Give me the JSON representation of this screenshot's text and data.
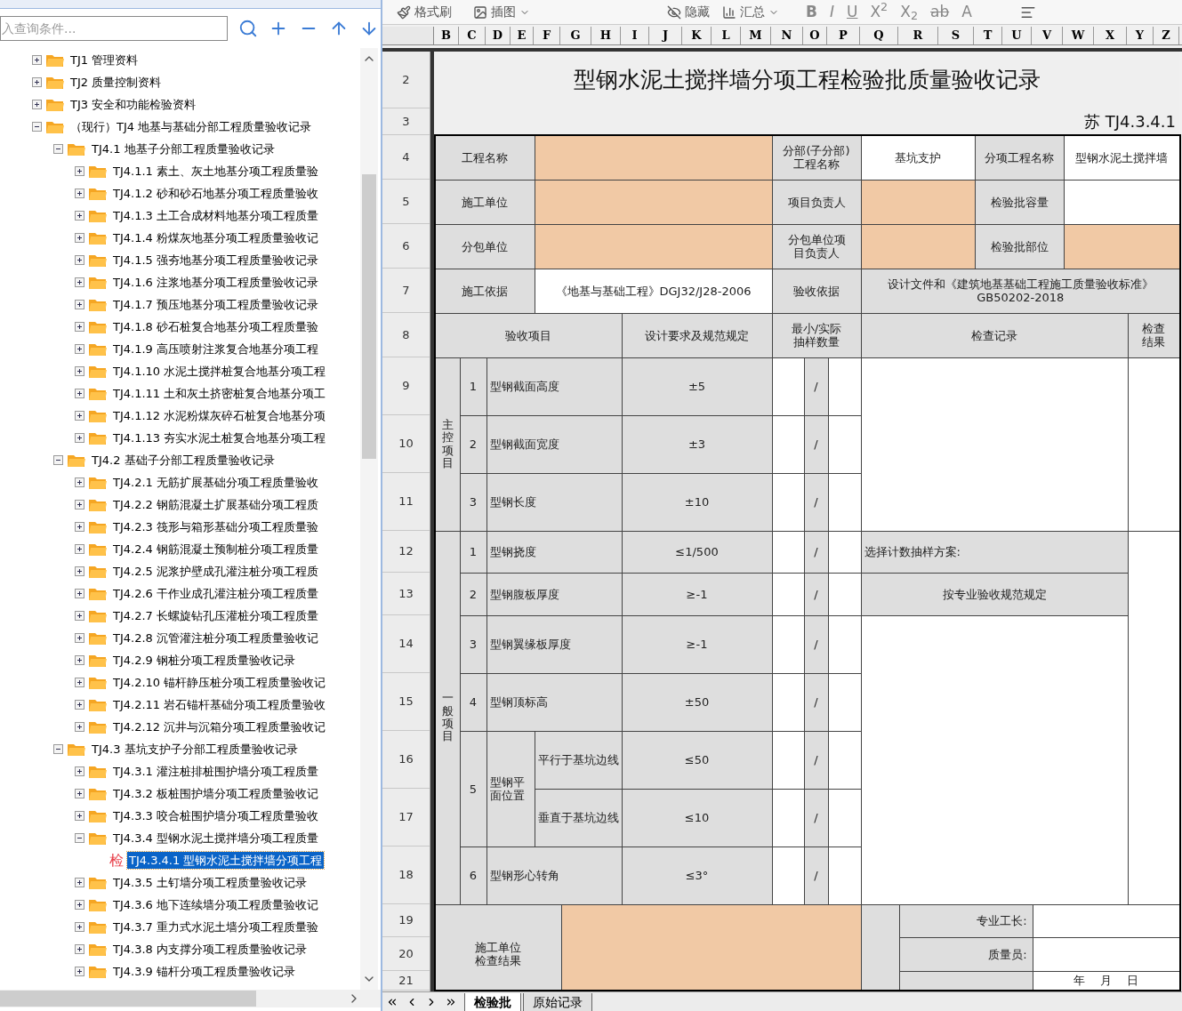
{
  "search": {
    "placeholder": "入查询条件..."
  },
  "tree": [
    {
      "label": "TJ1 管理资料",
      "expanded": false,
      "selected": false
    },
    {
      "label": "TJ2 质量控制资料",
      "expanded": false,
      "selected": false
    },
    {
      "label": "TJ3 安全和功能检验资料",
      "expanded": false,
      "selected": false
    },
    {
      "label": "（现行）TJ4 地基与基础分部工程质量验收记录",
      "expanded": true,
      "selected": false,
      "children": [
        {
          "label": "TJ4.1 地基子分部工程质量验收记录",
          "expanded": true,
          "selected": false,
          "children": [
            {
              "label": "TJ4.1.1 素土、灰土地基分项工程质量验",
              "expanded": false,
              "selected": false
            },
            {
              "label": "TJ4.1.2 砂和砂石地基分项工程质量验收",
              "expanded": false,
              "selected": false
            },
            {
              "label": "TJ4.1.3 土工合成材料地基分项工程质量",
              "expanded": false,
              "selected": false
            },
            {
              "label": "TJ4.1.4 粉煤灰地基分项工程质量验收记",
              "expanded": false,
              "selected": false
            },
            {
              "label": "TJ4.1.5 强夯地基分项工程质量验收记录",
              "expanded": false,
              "selected": false
            },
            {
              "label": "TJ4.1.6 注浆地基分项工程质量验收记录",
              "expanded": false,
              "selected": false
            },
            {
              "label": "TJ4.1.7 预压地基分项工程质量验收记录",
              "expanded": false,
              "selected": false
            },
            {
              "label": "TJ4.1.8 砂石桩复合地基分项工程质量验",
              "expanded": false,
              "selected": false
            },
            {
              "label": "TJ4.1.9 高压喷射注浆复合地基分项工程",
              "expanded": false,
              "selected": false
            },
            {
              "label": "TJ4.1.10 水泥土搅拌桩复合地基分项工程",
              "expanded": false,
              "selected": false
            },
            {
              "label": "TJ4.1.11 土和灰土挤密桩复合地基分项工",
              "expanded": false,
              "selected": false
            },
            {
              "label": "TJ4.1.12 水泥粉煤灰碎石桩复合地基分项",
              "expanded": false,
              "selected": false
            },
            {
              "label": "TJ4.1.13 夯实水泥土桩复合地基分项工程",
              "expanded": false,
              "selected": false
            }
          ]
        },
        {
          "label": "TJ4.2 基础子分部工程质量验收记录",
          "expanded": true,
          "selected": false,
          "children": [
            {
              "label": "TJ4.2.1 无筋扩展基础分项工程质量验收",
              "expanded": false,
              "selected": false
            },
            {
              "label": "TJ4.2.2 钢筋混凝土扩展基础分项工程质",
              "expanded": false,
              "selected": false
            },
            {
              "label": "TJ4.2.3 筏形与箱形基础分项工程质量验",
              "expanded": false,
              "selected": false
            },
            {
              "label": "TJ4.2.4 钢筋混凝土预制桩分项工程质量",
              "expanded": false,
              "selected": false
            },
            {
              "label": "TJ4.2.5 泥浆护壁成孔灌注桩分项工程质",
              "expanded": false,
              "selected": false
            },
            {
              "label": "TJ4.2.6 干作业成孔灌注桩分项工程质量",
              "expanded": false,
              "selected": false
            },
            {
              "label": "TJ4.2.7 长螺旋钻孔压灌桩分项工程质量",
              "expanded": false,
              "selected": false
            },
            {
              "label": "TJ4.2.8 沉管灌注桩分项工程质量验收记",
              "expanded": false,
              "selected": false
            },
            {
              "label": "TJ4.2.9 钢桩分项工程质量验收记录",
              "expanded": false,
              "selected": false
            },
            {
              "label": "TJ4.2.10 锚杆静压桩分项工程质量验收记",
              "expanded": false,
              "selected": false
            },
            {
              "label": "TJ4.2.11 岩石锚杆基础分项工程质量验收",
              "expanded": false,
              "selected": false
            },
            {
              "label": "TJ4.2.12 沉井与沉箱分项工程质量验收记",
              "expanded": false,
              "selected": false
            }
          ]
        },
        {
          "label": "TJ4.3 基坑支护子分部工程质量验收记录",
          "expanded": true,
          "selected": false,
          "children": [
            {
              "label": "TJ4.3.1 灌注桩排桩围护墙分项工程质量",
              "expanded": false,
              "selected": false
            },
            {
              "label": "TJ4.3.2 板桩围护墙分项工程质量验收记",
              "expanded": false,
              "selected": false
            },
            {
              "label": "TJ4.3.3 咬合桩围护墙分项工程质量验收",
              "expanded": false,
              "selected": false
            },
            {
              "label": "TJ4.3.4 型钢水泥土搅拌墙分项工程质量",
              "expanded": true,
              "selected": false,
              "children": [
                {
                  "label": "TJ4.3.4.1 型钢水泥土搅拌墙分项工程",
                  "kind": "form",
                  "badge": "检",
                  "selected": true
                }
              ]
            },
            {
              "label": "TJ4.3.5 土钉墙分项工程质量验收记录",
              "expanded": false,
              "selected": false
            },
            {
              "label": "TJ4.3.6 地下连续墙分项工程质量验收记",
              "expanded": false,
              "selected": false
            },
            {
              "label": "TJ4.3.7 重力式水泥土墙分项工程质量验",
              "expanded": false,
              "selected": false
            },
            {
              "label": "TJ4.3.8 内支撑分项工程质量验收记录",
              "expanded": false,
              "selected": false
            },
            {
              "label": "TJ4.3.9 锚杆分项工程质量验收记录",
              "expanded": false,
              "selected": false
            }
          ]
        }
      ]
    }
  ],
  "toolbar": {
    "format_painter": "格式刷",
    "insert_picture": "插图",
    "hide": "隐藏",
    "summary": "汇总",
    "format_buttons": [
      "B",
      "I",
      "U",
      "X$^{2}$",
      "X$_{2}$",
      "ab",
      "A"
    ]
  },
  "sheet": {
    "columns": [
      "B",
      "C",
      "D",
      "E",
      "F",
      "G",
      "H",
      "I",
      "J",
      "K",
      "L",
      "M",
      "N",
      "O",
      "P",
      "Q",
      "R",
      "S",
      "T",
      "U",
      "V",
      "W",
      "X",
      "Y",
      "Z"
    ],
    "row_numbers": [
      "2",
      "3",
      "4",
      "5",
      "6",
      "7",
      "8",
      "9",
      "10",
      "11",
      "12",
      "13",
      "14",
      "15",
      "16",
      "17",
      "18",
      "19",
      "20",
      "21"
    ],
    "title": "型钢水泥土搅拌墙分项工程检验批质量验收记录",
    "form_code": "苏 TJ4.3.4.1",
    "info": {
      "project_label": "工程名称",
      "division_label": "分部(子分部)工程名称",
      "division_value": "基坑支护",
      "item_label": "分项工程名称",
      "item_value": "型钢水泥土搅拌墙",
      "contractor_label": "施工单位",
      "manager_label": "项目负责人",
      "capacity_label": "检验批容量",
      "subcontractor_label": "分包单位",
      "sub_manager_label": "分包单位项目负责人",
      "location_label": "检验批部位",
      "basis_label": "施工依据",
      "basis_value": "《地基与基础工程》DGJ32/J28-2006",
      "acceptance_label": "验收依据",
      "acceptance_value": "设计文件和《建筑地基基础工程施工质量验收标准》GB50202-2018"
    },
    "headers": {
      "item": "验收项目",
      "spec": "设计要求及规范规定",
      "sample": "最小/实际抽样数量",
      "record": "检查记录",
      "result": "检查结果"
    },
    "main": {
      "category": "主控项目",
      "items": [
        {
          "no": "1",
          "name": "型钢截面高度",
          "spec": "±5",
          "sample_sep": "/"
        },
        {
          "no": "2",
          "name": "型钢截面宽度",
          "spec": "±3",
          "sample_sep": "/"
        },
        {
          "no": "3",
          "name": "型钢长度",
          "spec": "±10",
          "sample_sep": "/"
        }
      ]
    },
    "general": {
      "category": "一般项目",
      "sampling_label": "选择计数抽样方案:",
      "sampling_value": "按专业验收规范规定",
      "items": [
        {
          "no": "1",
          "name": "型钢挠度",
          "spec": "≤1/500",
          "sample_sep": "/"
        },
        {
          "no": "2",
          "name": "型钢腹板厚度",
          "spec": "≥-1",
          "sample_sep": "/"
        },
        {
          "no": "3",
          "name": "型钢翼缘板厚度",
          "spec": "≥-1",
          "sample_sep": "/"
        },
        {
          "no": "4",
          "name": "型钢顶标高",
          "spec": "±50",
          "sample_sep": "/"
        },
        {
          "no": "5",
          "name": "型钢平面位置",
          "subs": [
            {
              "name": "平行于基坑边线",
              "spec": "≤50",
              "sample_sep": "/"
            },
            {
              "name": "垂直于基坑边线",
              "spec": "≤10",
              "sample_sep": "/"
            }
          ]
        },
        {
          "no": "6",
          "name": "型钢形心转角",
          "spec": "≤3°",
          "sample_sep": "/"
        }
      ]
    },
    "conclusion": {
      "label": "施工单位检查结果",
      "foreman_label": "专业工长:",
      "inspector_label": "质量员:",
      "date": "年　 月　 日"
    }
  },
  "sheet_tabs": [
    {
      "label": "检验批",
      "selected": true
    },
    {
      "label": "原始记录",
      "selected": false
    }
  ]
}
